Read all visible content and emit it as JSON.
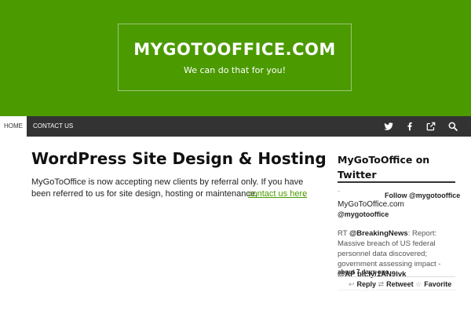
{
  "header": {
    "site_title": "MYGOTOOFFICE.COM",
    "tagline": "We can do that for you!",
    "bg_color": "#4b9a00"
  },
  "nav": {
    "items": [
      {
        "label": "HOME",
        "active": true
      },
      {
        "label": "CONTACT US",
        "active": false
      }
    ],
    "icons": [
      "twitter-icon",
      "facebook-icon",
      "external-link-icon",
      "search-icon"
    ]
  },
  "post": {
    "title": "WordPress Site Design & Hosting",
    "line1": "MyGoToOffice is now accepting new clients by referral only. If you have",
    "line2": "been referred to us for site design, hosting or maintenance,",
    "link_text": "contact us here",
    "after_link": "."
  },
  "sidebar": {
    "widget_title": "MyGoToOffice on Twitter",
    "tweet": {
      "follow_label": "Follow @mygotooffice",
      "display_name": "MyGoToOffice.com",
      "handle": "@mygotooffice",
      "rt_prefix": "RT",
      "mention": "@BreakingNews",
      "body": ": Report: Massive breach of US federal personnel data discovered; government assessing impact - ",
      "mention2": "@AP",
      "url": "bit.ly/1AN9lvk",
      "time": "about 7 days ago",
      "reply_label": "Reply",
      "retweet_label": "Retweet",
      "favorite_label": "Favorite"
    }
  }
}
